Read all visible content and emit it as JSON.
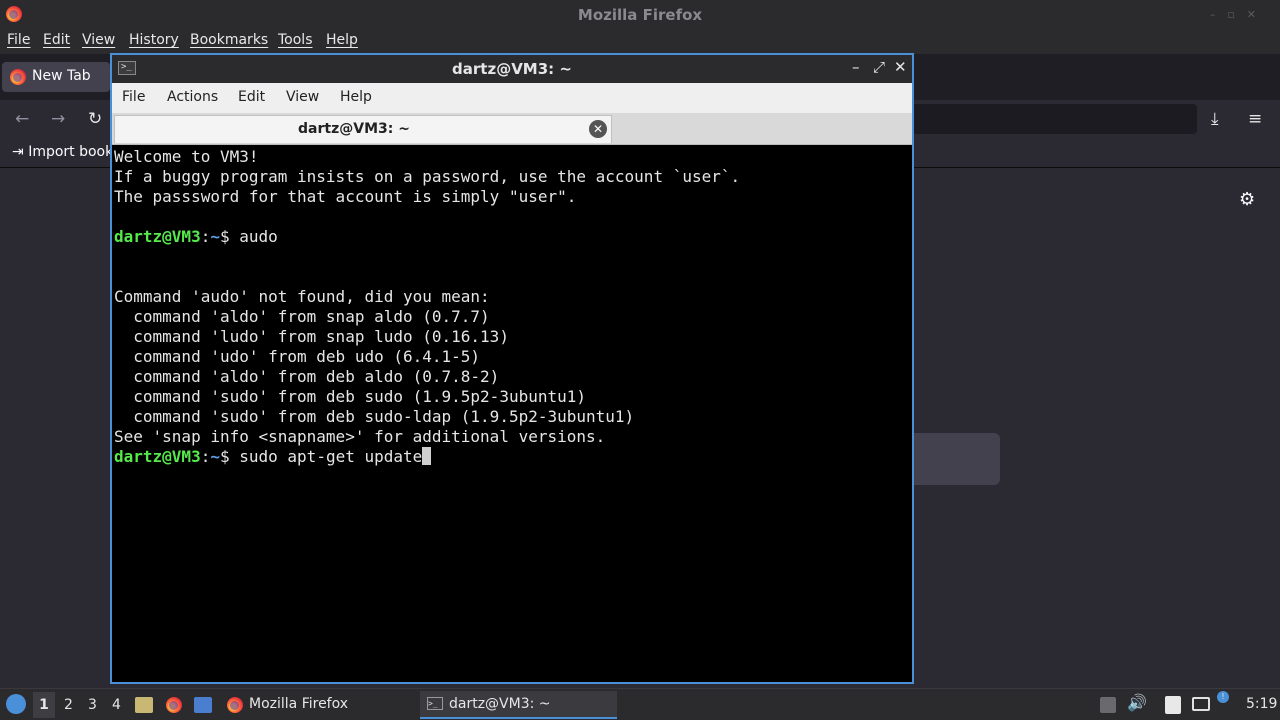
{
  "firefox": {
    "window_title": "Mozilla Firefox",
    "menu": [
      "File",
      "Edit",
      "View",
      "History",
      "Bookmarks",
      "Tools",
      "Help"
    ],
    "tab_label": "New Tab",
    "import_bookmarks_label": "Import book"
  },
  "terminal": {
    "window_title": "dartz@VM3: ~",
    "menu": [
      "File",
      "Actions",
      "Edit",
      "View",
      "Help"
    ],
    "tab_label": "dartz@VM3: ~",
    "lines": [
      {
        "text": "Welcome to VM3!"
      },
      {
        "text": "If a buggy program insists on a password, use the account `user`."
      },
      {
        "text": "The passsword for that account is simply \"user\"."
      },
      {
        "text": ""
      },
      {
        "prompt_user": "dartz@VM3",
        "prompt_sep": ":",
        "prompt_path": "~",
        "prompt_end": "$ ",
        "command": "audo"
      },
      {
        "text": ""
      },
      {
        "text": ""
      },
      {
        "text": "Command 'audo' not found, did you mean:"
      },
      {
        "text": "  command 'aldo' from snap aldo (0.7.7)"
      },
      {
        "text": "  command 'ludo' from snap ludo (0.16.13)"
      },
      {
        "text": "  command 'udo' from deb udo (6.4.1-5)"
      },
      {
        "text": "  command 'aldo' from deb aldo (0.7.8-2)"
      },
      {
        "text": "  command 'sudo' from deb sudo (1.9.5p2-3ubuntu1)"
      },
      {
        "text": "  command 'sudo' from deb sudo-ldap (1.9.5p2-3ubuntu1)"
      },
      {
        "text": "See 'snap info <snapname>' for additional versions."
      },
      {
        "prompt_user": "dartz@VM3",
        "prompt_sep": ":",
        "prompt_path": "~",
        "prompt_end": "$ ",
        "command": "sudo apt-get update",
        "cursor": true
      }
    ]
  },
  "taskbar": {
    "workspaces": [
      "1",
      "2",
      "3",
      "4"
    ],
    "tasks": [
      {
        "label": "Mozilla Firefox",
        "icon": "firefox-icon"
      },
      {
        "label": "dartz@VM3: ~",
        "icon": "terminal-icon",
        "active": true
      }
    ],
    "clock": "5:19"
  },
  "colors": {
    "prompt_user": "#55e94b",
    "prompt_path": "#5e9ee8",
    "window_border_active": "#4a90d9"
  }
}
